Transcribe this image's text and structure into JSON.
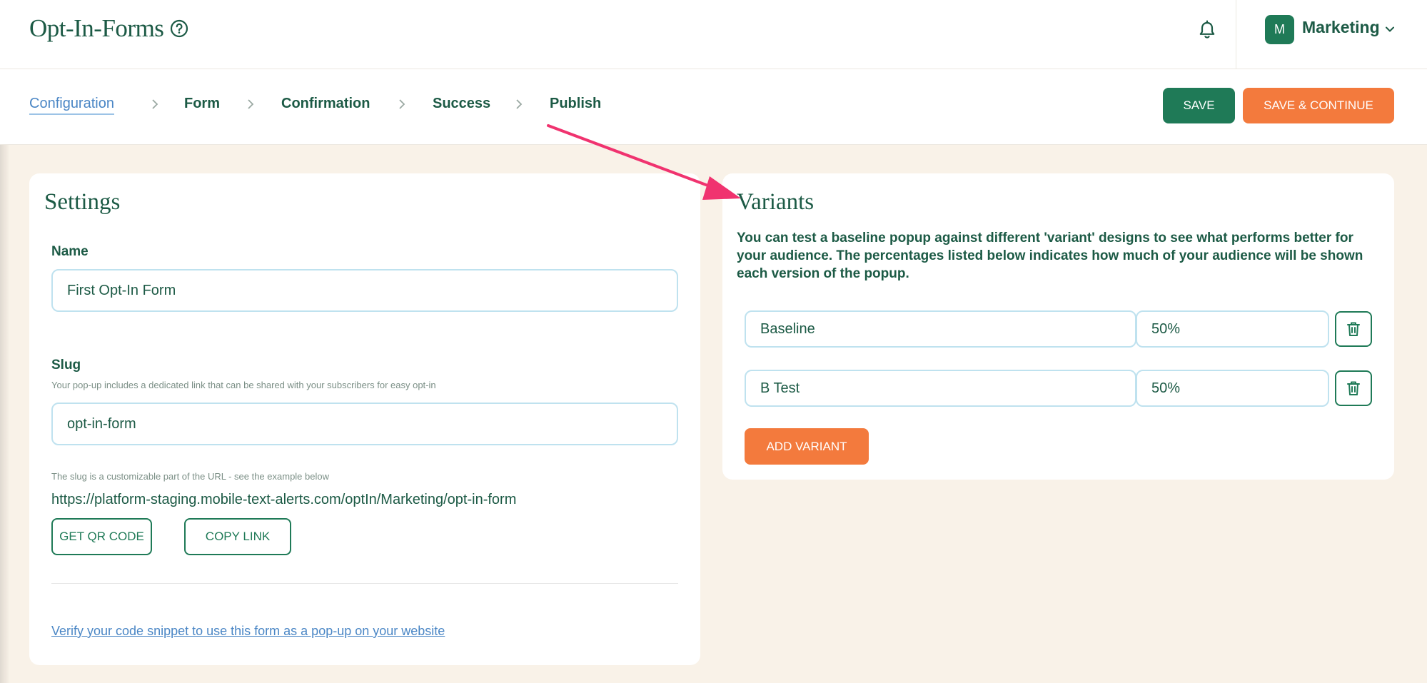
{
  "header": {
    "title": "Opt-In-Forms",
    "help_icon": "help-circle-icon",
    "notification_icon": "bell-icon",
    "account": {
      "avatar_letter": "M",
      "name": "Marketing",
      "chevron_icon": "chevron-down-icon"
    }
  },
  "steps": {
    "items": [
      {
        "label": "Configuration",
        "active": true
      },
      {
        "label": "Form",
        "active": false
      },
      {
        "label": "Confirmation",
        "active": false
      },
      {
        "label": "Success",
        "active": false
      },
      {
        "label": "Publish",
        "active": false
      }
    ],
    "separator_icon": "chevron-right-icon",
    "save_label": "SAVE",
    "save_continue_label": "SAVE & CONTINUE"
  },
  "settings": {
    "title": "Settings",
    "name_label": "Name",
    "name_value": "First Opt-In Form",
    "slug_label": "Slug",
    "slug_hint": "Your pop-up includes a dedicated link that can be shared with your subscribers for easy opt-in",
    "slug_value": "opt-in-form",
    "slug_note": "The slug is a customizable part of the URL - see the example below",
    "url": "https://platform-staging.mobile-text-alerts.com/optIn/Marketing/opt-in-form",
    "qr_label": "GET QR CODE",
    "copy_label": "COPY LINK",
    "verify_link": "Verify your code snippet to use this form as a pop-up on your website"
  },
  "variants": {
    "title": "Variants",
    "description": "You can test a baseline popup against different 'variant' designs to see what performs better for your audience. The percentages listed below indicates how much of your audience will be shown each version of the popup.",
    "rows": [
      {
        "name": "Baseline",
        "percent": "50%"
      },
      {
        "name": "B Test",
        "percent": "50%"
      }
    ],
    "delete_icon": "trash-icon",
    "add_label": "ADD VARIANT"
  },
  "colors": {
    "brand_green": "#1f7a57",
    "text_green": "#1c5a45",
    "accent_orange": "#f37a3d",
    "link_blue": "#4a86c5",
    "page_bg": "#f9f2e8",
    "annotation_pink": "#f0336f"
  }
}
